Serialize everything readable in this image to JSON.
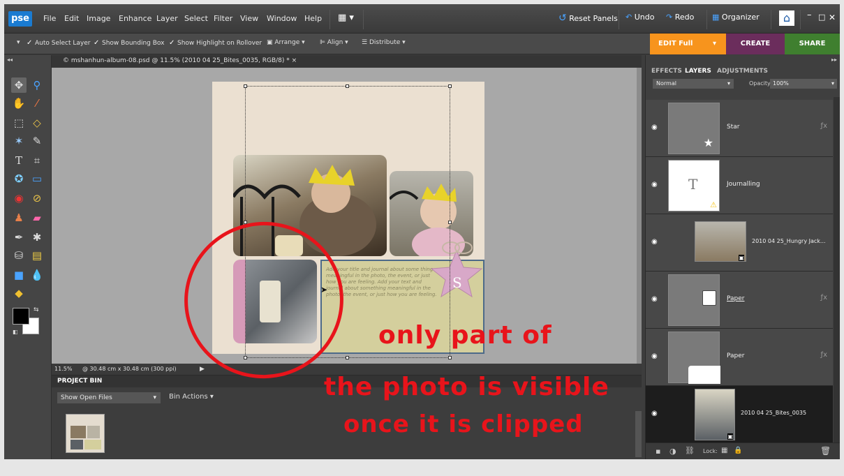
{
  "menubar": {
    "logo": "pse",
    "items": [
      "File",
      "Edit",
      "Image",
      "Enhance",
      "Layer",
      "Select",
      "Filter",
      "View",
      "Window",
      "Help"
    ],
    "reset_panels": "Reset Panels",
    "undo": "Undo",
    "redo": "Redo",
    "organizer": "Organizer"
  },
  "options": {
    "auto_select": "Auto Select Layer",
    "bounding_box": "Show Bounding Box",
    "highlight": "Show Highlight on Rollover",
    "arrange": "Arrange",
    "align": "Align",
    "distribute": "Distribute"
  },
  "modes": {
    "edit": "EDIT Full",
    "create": "CREATE",
    "share": "SHARE"
  },
  "document": {
    "tab_title": "© mshanhun-album-08.psd @ 11.5% (2010 04 25_Bites_0035, RGB/8) * ×",
    "zoom": "11.5%",
    "size": "@ 30.48 cm x 30.48 cm (300 ppi)",
    "journal_text": "Add your title and journal about some thing meaningful in the photo, the event, or just how you are feeling. Add your text and journal about something meaningful in the photo, the event, or just how you are feeling.",
    "star_letter": "S"
  },
  "bin": {
    "title": "PROJECT BIN",
    "select": "Show Open Files",
    "actions": "Bin Actions"
  },
  "panel": {
    "tabs": [
      "EFFECTS",
      "LAYERS",
      "ADJUSTMENTS"
    ],
    "blend": "Normal",
    "opacity_label": "Opacity:",
    "opacity_value": "100%",
    "lock_label": "Lock:",
    "layers": [
      {
        "name": "Star"
      },
      {
        "name": "Journalling"
      },
      {
        "name": "2010 04 25_Hungry Jack..."
      },
      {
        "name": "Paper"
      },
      {
        "name": "Paper"
      },
      {
        "name": "2010 04 25_Bites_0035"
      }
    ]
  },
  "annotation": {
    "line1": "only part of",
    "line2": "the photo is visible",
    "line3": "once it is clipped"
  },
  "colors": {
    "accent_orange": "#f7941d",
    "create_purple": "#6b2d5c",
    "share_green": "#3f7f2f",
    "annotation_red": "#e8141b"
  }
}
